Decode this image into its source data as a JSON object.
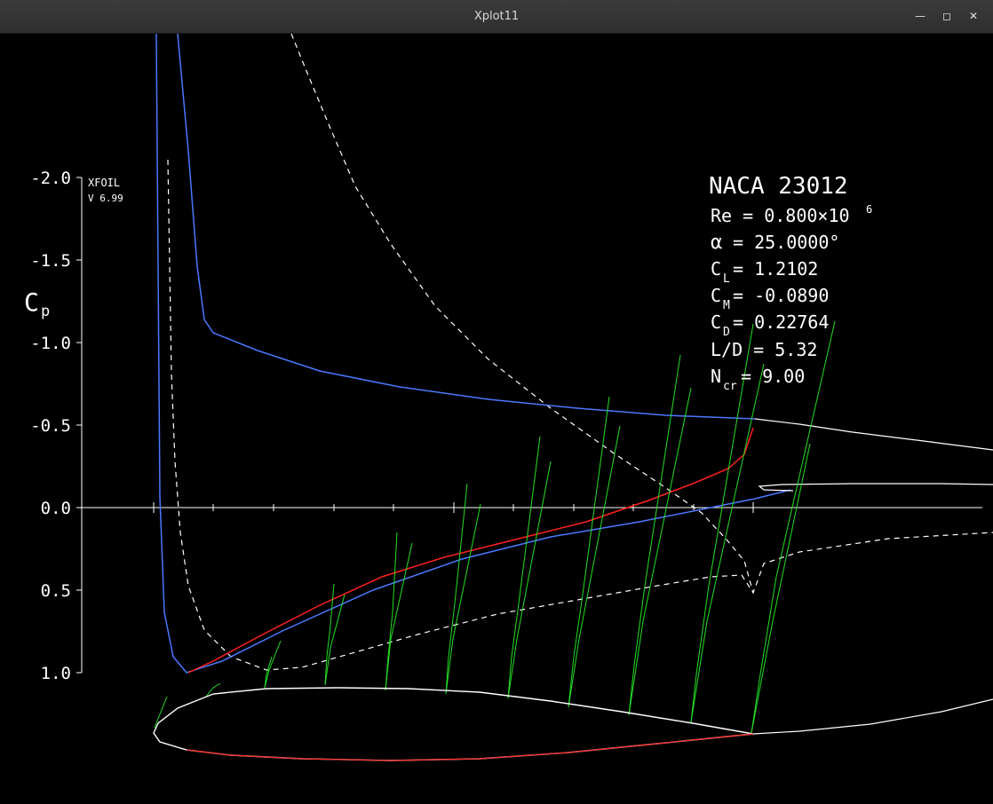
{
  "window": {
    "title": "Xplot11",
    "minimize_glyph": "—",
    "maximize_glyph": "◻",
    "close_glyph": "✕"
  },
  "plot": {
    "program": "XFOIL",
    "version": "V 6.99",
    "y_label": "C",
    "y_label_sub": "p",
    "y_ticks": [
      "-2.0",
      "-1.5",
      "-1.0",
      "-0.5",
      "0.0",
      "0.5",
      "1.0"
    ],
    "info": {
      "airfoil": "NACA 23012",
      "re_label": "Re  = 0.800×10",
      "re_exp": "6",
      "alpha_symbol": "α",
      "alpha_value": " = 25.0000°",
      "cl_label": "C",
      "cl_sub": "L",
      "cl_value": " = 1.2102",
      "cm_label": "C",
      "cm_sub": "M",
      "cm_value": " = -0.0890",
      "cd_label": "C",
      "cd_sub": "D",
      "cd_value": " = 0.22764",
      "ld_text": "L/D = 5.32",
      "ncr_label": "N",
      "ncr_sub": "cr",
      "ncr_value": " = 9.00"
    },
    "colors": {
      "background": "#000000",
      "axes": "#ffffff",
      "viscous_cp": "#4a78ff",
      "inviscid_cp": "#ff2020",
      "boundary_layer": "#22e022",
      "airfoil": "#ffffff"
    }
  }
}
